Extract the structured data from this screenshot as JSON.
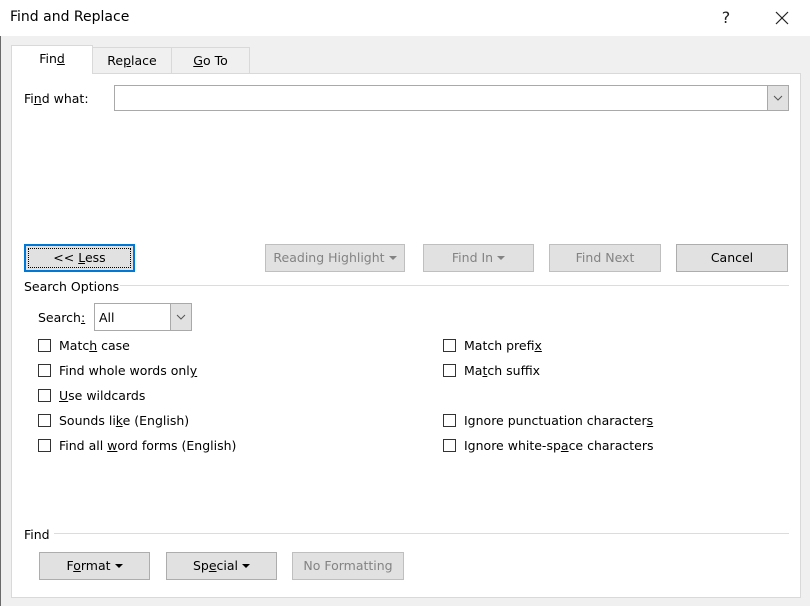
{
  "window": {
    "title": "Find and Replace",
    "help_label": "?",
    "close_icon": "close-icon"
  },
  "tabs": [
    {
      "label_pre": "Fin",
      "label_u": "d",
      "label_post": "",
      "active": true
    },
    {
      "label_pre": "Re",
      "label_u": "p",
      "label_post": "lace",
      "active": false
    },
    {
      "label_pre": "",
      "label_u": "G",
      "label_post": "o To",
      "active": false
    }
  ],
  "find_what": {
    "label_pre": "Fi",
    "label_u": "n",
    "label_post": "d what:",
    "value": "",
    "dropdown_icon": "chevron-down-icon"
  },
  "buttons": {
    "less": {
      "pre": "<< ",
      "u": "L",
      "post": "ess",
      "focused": true
    },
    "reading_highlight": {
      "label": "Reading Highlight",
      "disabled": true,
      "has_menu": true
    },
    "find_in": {
      "label": "Find In",
      "disabled": true,
      "has_menu": true
    },
    "find_next": {
      "label": "Find Next",
      "disabled": true
    },
    "cancel": {
      "label": "Cancel",
      "disabled": false
    }
  },
  "search_options": {
    "heading": "Search Options",
    "search_label_pre": "Search",
    "search_label_u": ":",
    "search_value": "All",
    "left_options": [
      {
        "pre": "Matc",
        "u": "h",
        "post": " case",
        "checked": false
      },
      {
        "pre": "Find whole words onl",
        "u": "y",
        "post": "",
        "checked": false
      },
      {
        "pre": "",
        "u": "U",
        "post": "se wildcards",
        "checked": false
      },
      {
        "pre": "Sounds li",
        "u": "k",
        "post": "e (English)",
        "checked": false
      },
      {
        "pre": "Find all ",
        "u": "w",
        "post": "ord forms (English)",
        "checked": false
      }
    ],
    "right_options": [
      {
        "pre": "Match prefi",
        "u": "x",
        "post": "",
        "checked": false
      },
      {
        "pre": "Ma",
        "u": "t",
        "post": "ch suffix",
        "checked": false
      },
      {
        "pre": "Ignore punctuation character",
        "u": "s",
        "post": "",
        "checked": false
      },
      {
        "pre": "Ignore white-sp",
        "u": "a",
        "post": "ce characters",
        "checked": false
      }
    ]
  },
  "find_section": {
    "heading": "Find",
    "format": {
      "pre": "F",
      "u": "o",
      "post": "rmat",
      "has_menu": true
    },
    "special": {
      "pre": "Sp",
      "u": "e",
      "post": "cial",
      "has_menu": true
    },
    "no_formatting": {
      "label": "No Formatting",
      "disabled": true
    }
  }
}
